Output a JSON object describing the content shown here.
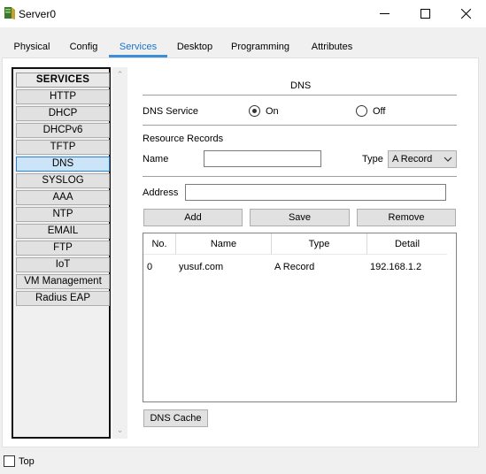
{
  "window": {
    "title": "Server0",
    "icon": "server-app-icon",
    "controls": [
      "minimize-icon",
      "maximize-icon",
      "close-icon"
    ]
  },
  "tabs": [
    {
      "label": "Physical",
      "active": false
    },
    {
      "label": "Config",
      "active": false
    },
    {
      "label": "Services",
      "active": true
    },
    {
      "label": "Desktop",
      "active": false
    },
    {
      "label": "Programming",
      "active": false
    },
    {
      "label": "Attributes",
      "active": false
    }
  ],
  "services": {
    "header": "SERVICES",
    "items": [
      "HTTP",
      "DHCP",
      "DHCPv6",
      "TFTP",
      "DNS",
      "SYSLOG",
      "AAA",
      "NTP",
      "EMAIL",
      "FTP",
      "IoT",
      "VM Management",
      "Radius EAP"
    ],
    "selected": "DNS"
  },
  "dns": {
    "title": "DNS",
    "service_label": "DNS Service",
    "on_label": "On",
    "off_label": "Off",
    "service_state": "On",
    "resource_records_label": "Resource Records",
    "name_label": "Name",
    "name_value": "",
    "type_label": "Type",
    "type_value": "A Record",
    "address_label": "Address",
    "address_value": "",
    "buttons": {
      "add": "Add",
      "save": "Save",
      "remove": "Remove"
    },
    "table": {
      "columns": [
        "No.",
        "Name",
        "Type",
        "Detail"
      ],
      "rows": [
        [
          "0",
          "yusuf.com",
          "A Record",
          "192.168.1.2"
        ]
      ]
    },
    "cache_button": "DNS Cache"
  },
  "footer": {
    "top_label": "Top",
    "top_checked": false
  }
}
